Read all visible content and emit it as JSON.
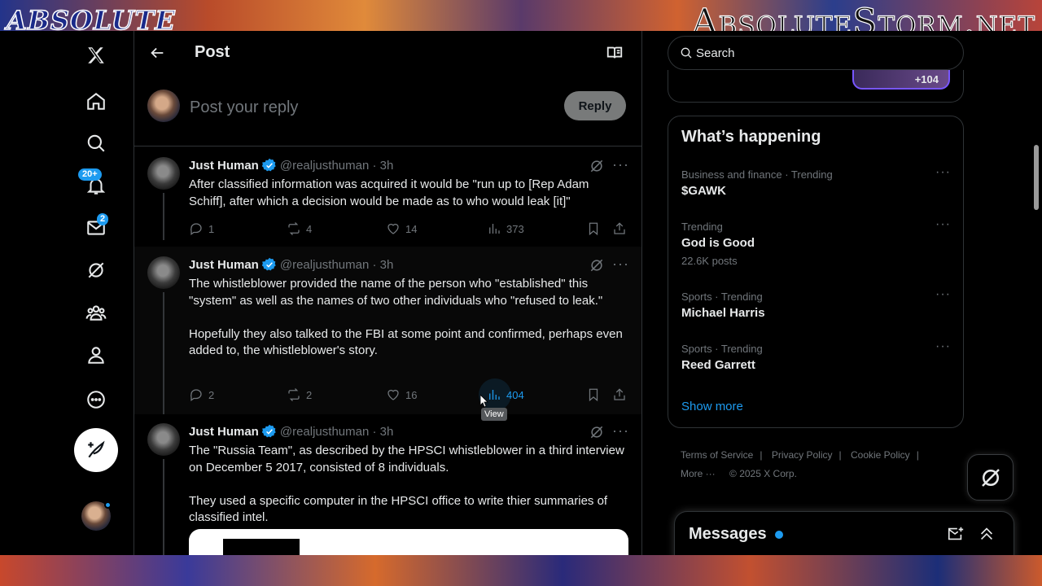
{
  "banner": {
    "left_brand": "ABSOLUTE",
    "right_brand": "AbsoluteStorm.net"
  },
  "nav": {
    "notifications_badge": "20+",
    "messages_badge": "2"
  },
  "header": {
    "title": "Post"
  },
  "reply": {
    "placeholder": "Post your reply",
    "button": "Reply"
  },
  "tweets": [
    {
      "name": "Just Human",
      "handle": "@realjusthuman · 3h",
      "text": "After classified information was acquired it would be \"run up to [Rep Adam Schiff], after which a decision would be made as to who would leak [it]\"",
      "replies": "1",
      "reposts": "4",
      "likes": "14",
      "views": "373"
    },
    {
      "name": "Just Human",
      "handle": "@realjusthuman · 3h",
      "text": "The whistleblower provided the name of the person who \"established\" this \"system\" as well as the names of two other individuals who \"refused to leak.\"\n\nHopefully they also talked to the FBI at some point and confirmed, perhaps even added to, the whistleblower's story.",
      "replies": "2",
      "reposts": "2",
      "likes": "16",
      "views": "404",
      "tooltip": "View"
    },
    {
      "name": "Just Human",
      "handle": "@realjusthuman · 3h",
      "text": "The \"Russia Team\", as described by the HPSCI whistleblower in a third interview on December 5 2017, consisted of 8 individuals.\n\nThey used a specific computer in the HPSCI office to write thier summaries of classified intel."
    }
  ],
  "search": {
    "placeholder": "Search"
  },
  "spaces": {
    "count": "+104"
  },
  "trends": {
    "title": "What’s happening",
    "items": [
      {
        "meta": "Business and finance · Trending",
        "name": "$GAWK",
        "count": ""
      },
      {
        "meta": "Trending",
        "name": "God is Good",
        "count": "22.6K posts"
      },
      {
        "meta": "Sports · Trending",
        "name": "Michael Harris",
        "count": ""
      },
      {
        "meta": "Sports · Trending",
        "name": "Reed Garrett",
        "count": ""
      }
    ],
    "show_more": "Show more"
  },
  "footer": {
    "links": [
      "Terms of Service",
      "Privacy Policy",
      "Cookie Policy"
    ],
    "more": "More ···",
    "copyright": "© 2025 X Corp."
  },
  "messages": {
    "title": "Messages"
  },
  "colors": {
    "accent": "#1d9bf0",
    "background": "#000000",
    "text": "#e7e9ea",
    "muted": "#71767b",
    "border": "#2f3336"
  }
}
